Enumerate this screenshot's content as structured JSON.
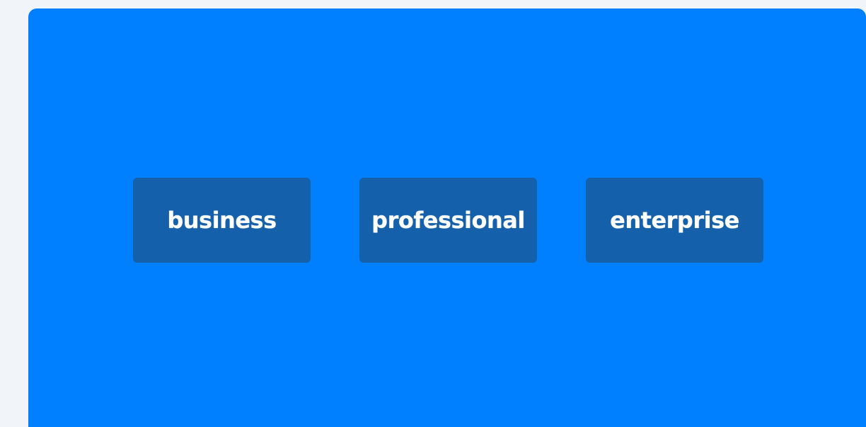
{
  "colors": {
    "page_background": "#f1f4f9",
    "panel_background": "#0080ff",
    "button_background": "#1560aa",
    "button_text": "#ffffff"
  },
  "plans": [
    {
      "label": "business"
    },
    {
      "label": "professional"
    },
    {
      "label": "enterprise"
    }
  ]
}
